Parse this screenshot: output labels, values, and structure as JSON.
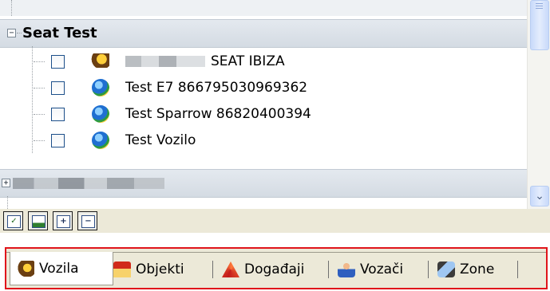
{
  "tree": {
    "group": {
      "label": "Seat Test",
      "expander": "−"
    },
    "items": [
      {
        "label": "SEAT IBIZA",
        "icon": "vehicle-icon",
        "has_blurred_prefix": true,
        "checked": false
      },
      {
        "label": "Test E7 866795030969362",
        "icon": "globe-icon",
        "checked": false
      },
      {
        "label": "Test Sparrow 86820400394",
        "icon": "globe-icon",
        "checked": false
      },
      {
        "label": "Test Vozilo",
        "icon": "globe-icon",
        "checked": false
      }
    ],
    "collapsed_group": {
      "expander": "+",
      "label_blurred": true
    }
  },
  "scrollbar": {
    "down_arrow": "⌄"
  },
  "toolbar": {
    "buttons": [
      {
        "name": "check-all",
        "glyph": "✓"
      },
      {
        "name": "uncheck-all",
        "glyph": ""
      },
      {
        "name": "expand-all",
        "glyph": "+"
      },
      {
        "name": "collapse-all",
        "glyph": "−"
      }
    ]
  },
  "tabs": [
    {
      "label": "Vozila",
      "icon": "vehicle-icon",
      "active": true
    },
    {
      "label": "Objekti",
      "icon": "building-icon",
      "active": false
    },
    {
      "label": "Događaji",
      "icon": "event-cone-icon",
      "active": false
    },
    {
      "label": "Vozači",
      "icon": "driver-icon",
      "active": false
    },
    {
      "label": "Zone",
      "icon": "zone-icon",
      "active": false
    }
  ],
  "colors": {
    "highlight_frame": "#e0141b",
    "group_bg": "#dbe1e8",
    "scroll_thumb": "#c8d9fa"
  }
}
